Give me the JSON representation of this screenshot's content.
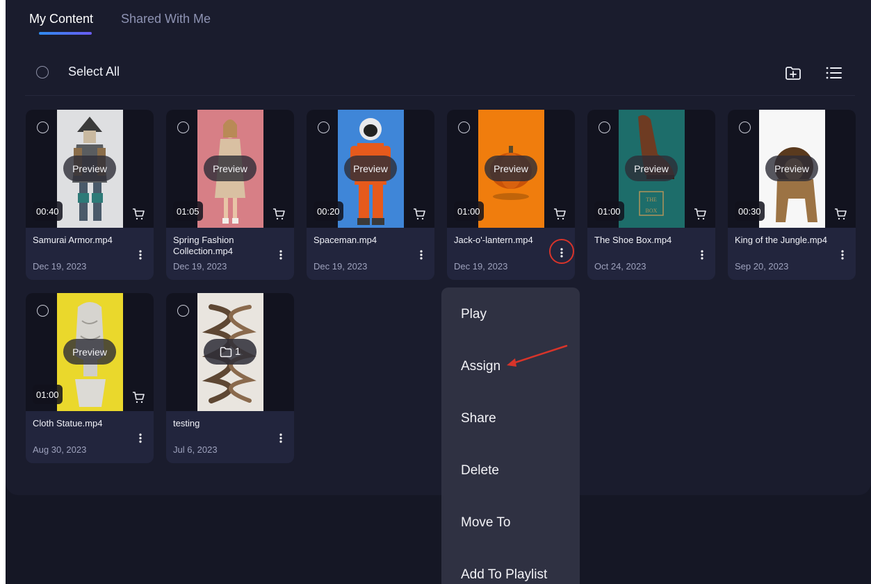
{
  "tabs": [
    {
      "label": "My Content",
      "active": true
    },
    {
      "label": "Shared With Me",
      "active": false
    }
  ],
  "toolbar": {
    "select_all_label": "Select All",
    "icons": [
      "new-folder-icon",
      "list-view-icon"
    ]
  },
  "items": [
    {
      "title": "Samurai Armor.mp4",
      "date": "Dec 19, 2023",
      "duration": "00:40",
      "preview": "Preview",
      "thumb": "samurai"
    },
    {
      "title": "Spring Fashion Collection.mp4",
      "date": "Dec 19, 2023",
      "duration": "01:05",
      "preview": "Preview",
      "thumb": "fashion"
    },
    {
      "title": "Spaceman.mp4",
      "date": "Dec 19, 2023",
      "duration": "00:20",
      "preview": "Preview",
      "thumb": "spaceman"
    },
    {
      "title": "Jack-o'-lantern.mp4",
      "date": "Dec 19, 2023",
      "duration": "01:00",
      "preview": "Preview",
      "thumb": "pumpkin",
      "menu_open": true
    },
    {
      "title": "The Shoe Box.mp4",
      "date": "Oct 24, 2023",
      "duration": "01:00",
      "preview": "Preview",
      "thumb": "shoe"
    },
    {
      "title": "King of the Jungle.mp4",
      "date": "Sep 20, 2023",
      "duration": "00:30",
      "preview": "Preview",
      "thumb": "lion"
    },
    {
      "title": "Cloth Statue.mp4",
      "date": "Aug 30, 2023",
      "duration": "01:00",
      "preview": "Preview",
      "thumb": "statue"
    },
    {
      "title": "testing",
      "date": "Jul 6, 2023",
      "folder_count": "1",
      "thumb": "spiral",
      "is_folder": true
    }
  ],
  "context_menu": {
    "items": [
      "Play",
      "Assign",
      "Share",
      "Delete",
      "Move To",
      "Add To Playlist"
    ]
  },
  "colors": {
    "accent_gradient": [
      "#2f8cf0",
      "#6a5cf2"
    ],
    "annotation_red": "#d8342a"
  }
}
